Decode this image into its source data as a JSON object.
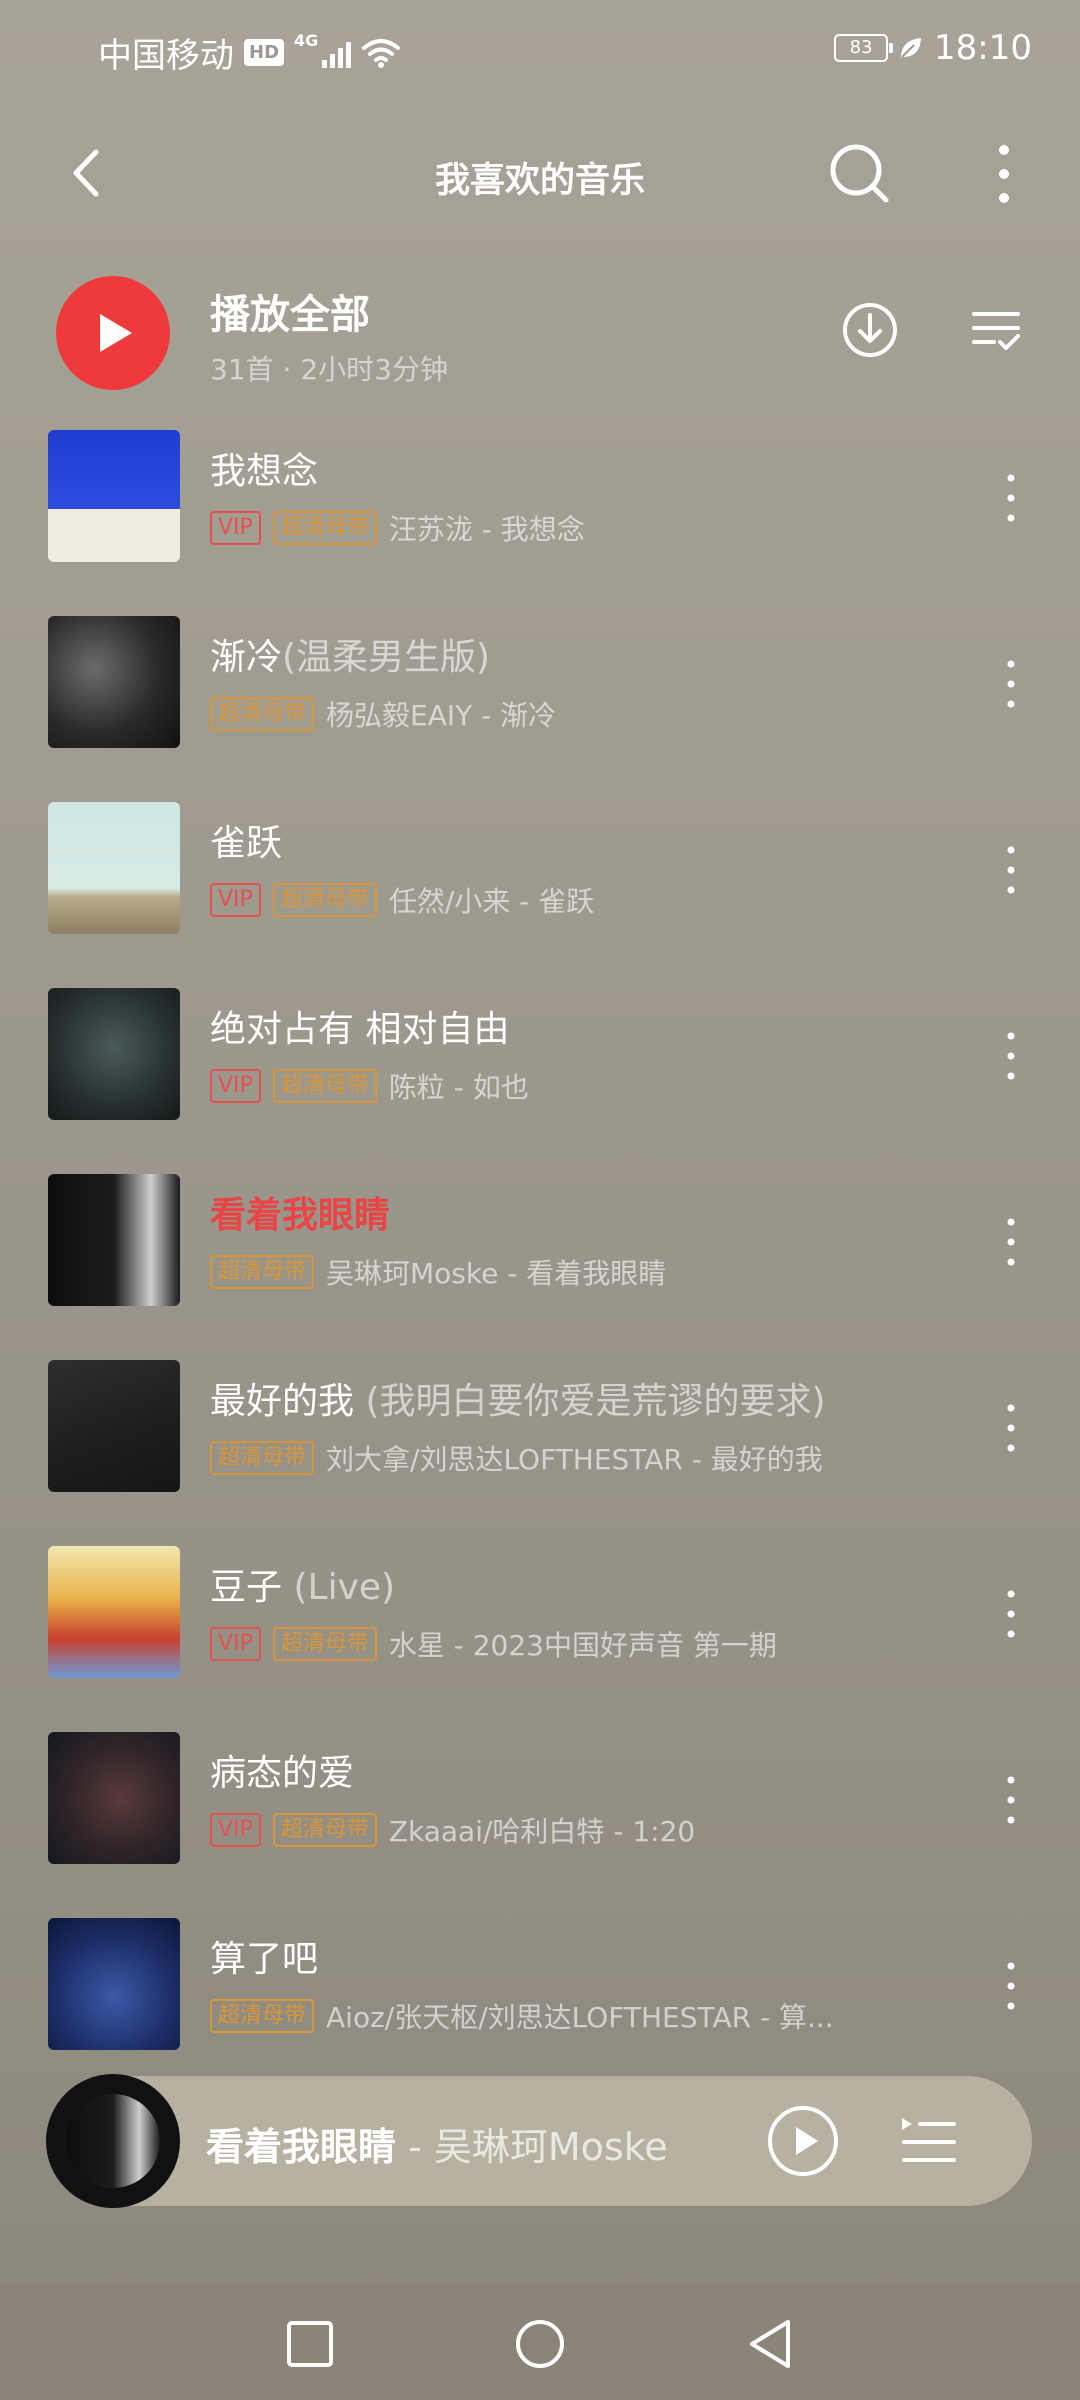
{
  "status_bar": {
    "carrier": "中国移动",
    "hd": "HD",
    "network": "4G",
    "battery": "83",
    "time": "18:10"
  },
  "header": {
    "title": "我喜欢的音乐",
    "icons": [
      "back-icon",
      "search-icon",
      "more-vertical-icon"
    ]
  },
  "play_all": {
    "label": "播放全部",
    "meta": "31首 · 2小时3分钟",
    "icons": [
      "download-icon",
      "multi-select-icon"
    ]
  },
  "songs": [
    {
      "title": "我想念",
      "subtitle": "",
      "vip": "VIP",
      "quality": "超清母带",
      "artist": "汪苏泷 - 我想念"
    },
    {
      "title": "渐冷",
      "subtitle": "(温柔男生版)",
      "vip": "",
      "quality": "超清母带",
      "artist": "杨弘毅EAIY - 渐冷"
    },
    {
      "title": "雀跃",
      "subtitle": "",
      "vip": "VIP",
      "quality": "超清母带",
      "artist": "任然/小来 - 雀跃"
    },
    {
      "title": "绝对占有 相对自由",
      "subtitle": "",
      "vip": "VIP",
      "quality": "超清母带",
      "artist": "陈粒 - 如也"
    },
    {
      "title": "看着我眼睛",
      "subtitle": "",
      "vip": "",
      "quality": "超清母带",
      "artist": "吴琳珂Moske - 看着我眼睛",
      "playing": true
    },
    {
      "title": "最好的我",
      "subtitle": "(我明白要你爱是荒谬的要求)",
      "vip": "",
      "quality": "超清母带",
      "artist": "刘大拿/刘思达LOFTHESTAR - 最好的我"
    },
    {
      "title": "豆子",
      "subtitle": "(Live)",
      "vip": "VIP",
      "quality": "超清母带",
      "artist": "水星 - 2023中国好声音 第一期"
    },
    {
      "title": "病态的爱",
      "subtitle": "",
      "vip": "VIP",
      "quality": "超清母带",
      "artist": "Zkaaai/哈利白特 - 1:20"
    },
    {
      "title": "算了吧",
      "subtitle": "",
      "vip": "",
      "quality": "超清母带",
      "artist": "Aioz/张天枢/刘思达LOFTHESTAR - 算..."
    }
  ],
  "mini_player": {
    "title": "看着我眼睛",
    "artist": " - 吴琳珂Moske",
    "icons": [
      "play-circle-icon",
      "playlist-icon"
    ]
  },
  "nav_bar": {
    "icons": [
      "recent-apps-icon",
      "home-icon",
      "back-nav-icon"
    ]
  },
  "colors": {
    "accent": "#ee3a3a",
    "playing_title": "#e84545",
    "vip": "#e55050",
    "quality": "#d8963a"
  }
}
